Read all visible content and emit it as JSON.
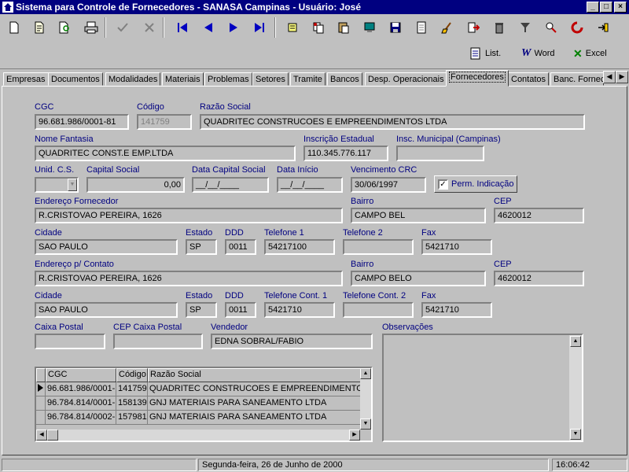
{
  "window": {
    "title": "Sistema para Controle de Fornecedores - SANASA Campinas  -  Usuário: José"
  },
  "toolbar": {
    "buttons": [
      "new-icon",
      "edit-icon",
      "search-doc-icon",
      "print-icon",
      "confirm-icon",
      "cancel-icon",
      "first-icon",
      "prev-icon",
      "next-icon",
      "last-icon",
      "import-icon",
      "copy-icon",
      "paste-icon",
      "computer-icon",
      "save-icon",
      "report-icon",
      "clean-icon",
      "export-icon",
      "delete-icon",
      "filter-icon",
      "zoom-icon",
      "refresh-icon",
      "exit-icon"
    ],
    "export_list": "List.",
    "export_word": "Word",
    "export_excel": "Excel"
  },
  "tabs": [
    "Empresas",
    "Documentos",
    "Modalidades",
    "Materiais",
    "Problemas",
    "Setores",
    "Tramite",
    "Bancos",
    "Desp. Operacionais",
    "Fornecedores",
    "Contatos",
    "Banc. Fornec"
  ],
  "active_tab": "Fornecedores",
  "form": {
    "cgc_label": "CGC",
    "cgc": "96.681.986/0001-81",
    "codigo_label": "Código",
    "codigo": "141759",
    "razao_label": "Razão Social",
    "razao": "QUADRITEC CONSTRUCOES E EMPREENDIMENTOS LTDA",
    "fantasia_label": "Nome Fantasia",
    "fantasia": "QUADRITEC CONST.E EMP.LTDA",
    "insc_est_label": "Inscrição Estadual",
    "insc_est": "110.345.776.117",
    "insc_mun_label": "Insc. Municipal (Campinas)",
    "insc_mun": "",
    "unid_label": "Unid. C.S.",
    "unid": "",
    "capital_label": "Capital Social",
    "capital": "0,00",
    "data_capital_label": "Data Capital Social",
    "data_capital": "__/__/____",
    "data_inicio_label": "Data Início",
    "data_inicio": "__/__/____",
    "venc_label": "Vencimento CRC",
    "venc": "30/06/1997",
    "perm_label": "Perm. Indicação",
    "perm_checked": "✓",
    "end_label": "Endereço Fornecedor",
    "end": "R.CRISTOVAO PEREIRA, 1626",
    "bairro_label": "Bairro",
    "bairro": "CAMPO BEL",
    "cep_label": "CEP",
    "cep": "4620012",
    "cidade_label": "Cidade",
    "cidade": "SAO PAULO",
    "estado_label": "Estado",
    "estado": "SP",
    "ddd_label": "DDD",
    "ddd": "0011",
    "tel1_label": "Telefone 1",
    "tel1": "54217100",
    "tel2_label": "Telefone 2",
    "tel2": "",
    "fax_label": "Fax",
    "fax": "5421710",
    "end2_label": "Endereço p/ Contato",
    "end2": "R.CRISTOVAO PEREIRA, 1626",
    "bairro2_label": "Bairro",
    "bairro2": "CAMPO BELO",
    "cep2_label": "CEP",
    "cep2": "4620012",
    "cidade2_label": "Cidade",
    "cidade2": "SAO PAULO",
    "estado2_label": "Estado",
    "estado2": "SP",
    "ddd2_label": "DDD",
    "ddd2": "0011",
    "telc1_label": "Telefone Cont. 1",
    "telc1": "5421710",
    "telc2_label": "Telefone Cont. 2",
    "telc2": "",
    "fax2_label": "Fax",
    "fax2": "5421710",
    "caixa_label": "Caixa Postal",
    "caixa": "",
    "cep_caixa_label": "CEP Caixa Postal",
    "cep_caixa": "",
    "vendedor_label": "Vendedor",
    "vendedor": "EDNA SOBRAL/FABIO",
    "obs_label": "Observações"
  },
  "grid": {
    "headers": [
      "CGC",
      "Código",
      "Razão Social"
    ],
    "rows": [
      [
        "96.681.986/0001-",
        "141759",
        "QUADRITEC CONSTRUCOES E EMPREENDIMENTOS"
      ],
      [
        "96.784.814/0001-",
        "158139",
        "GNJ MATERIAIS PARA SANEAMENTO LTDA"
      ],
      [
        "96.784.814/0002-",
        "157981",
        "GNJ MATERIAIS PARA SANEAMENTO LTDA"
      ]
    ]
  },
  "status": {
    "date": "Segunda-feira, 26 de Junho de 2000",
    "time": "16:06:42"
  }
}
